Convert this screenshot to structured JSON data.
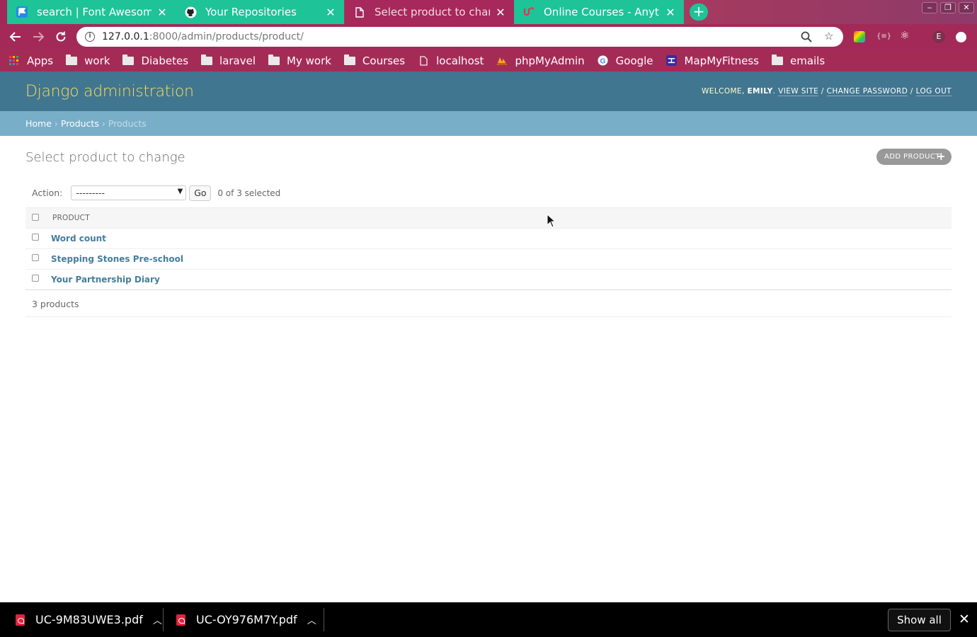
{
  "browser": {
    "tabs": [
      {
        "title": "search | Font Awesome"
      },
      {
        "title": "Your Repositories"
      },
      {
        "title": "Select product to change"
      },
      {
        "title": "Online Courses - Anytime"
      }
    ],
    "new_tab_label": "+",
    "url_host": "127.0.0.1",
    "url_rest": ":8000/admin/products/product/",
    "profile_initial": "E",
    "bookmarks": [
      {
        "label": "Apps",
        "icon": "apps-grid-icon"
      },
      {
        "label": "work",
        "icon": "folder-icon"
      },
      {
        "label": "Diabetes",
        "icon": "folder-icon"
      },
      {
        "label": "laravel",
        "icon": "folder-icon"
      },
      {
        "label": "My work",
        "icon": "folder-icon"
      },
      {
        "label": "Courses",
        "icon": "folder-icon"
      },
      {
        "label": "localhost",
        "icon": "page-icon"
      },
      {
        "label": "phpMyAdmin",
        "icon": "phpmyadmin-icon"
      },
      {
        "label": "Google",
        "icon": "google-icon"
      },
      {
        "label": "MapMyFitness",
        "icon": "mapmyfitness-icon"
      },
      {
        "label": "emails",
        "icon": "folder-icon"
      }
    ]
  },
  "admin": {
    "branding": "Django administration",
    "welcome_prefix": "WELCOME,",
    "username": "EMILY",
    "view_site": "VIEW SITE",
    "change_password": "CHANGE PASSWORD",
    "log_out": "LOG OUT",
    "breadcrumbs": {
      "home": "Home",
      "app": "Products",
      "current": "Products"
    },
    "title": "Select product to change",
    "add_button": "ADD PRODUCT",
    "action_label": "Action:",
    "action_selected": "---------",
    "go_label": "Go",
    "selection_counter": "0 of 3 selected",
    "column_header": "PRODUCT",
    "rows": [
      {
        "name": "Word count"
      },
      {
        "name": "Stepping Stones Pre-school"
      },
      {
        "name": "Your Partnership Diary"
      }
    ],
    "paginator": "3 products"
  },
  "downloads": {
    "items": [
      {
        "file": "UC-9M83UWE3.pdf"
      },
      {
        "file": "UC-OY976M7Y.pdf"
      }
    ],
    "show_all": "Show all"
  },
  "colors": {
    "header_bg": "#417690",
    "branding": "#f5dd5d",
    "breadcrumb_bg": "#79aec8",
    "link": "#447e9b",
    "tab_green": "#1ec398",
    "chrome_magenta": "#a32a58"
  }
}
